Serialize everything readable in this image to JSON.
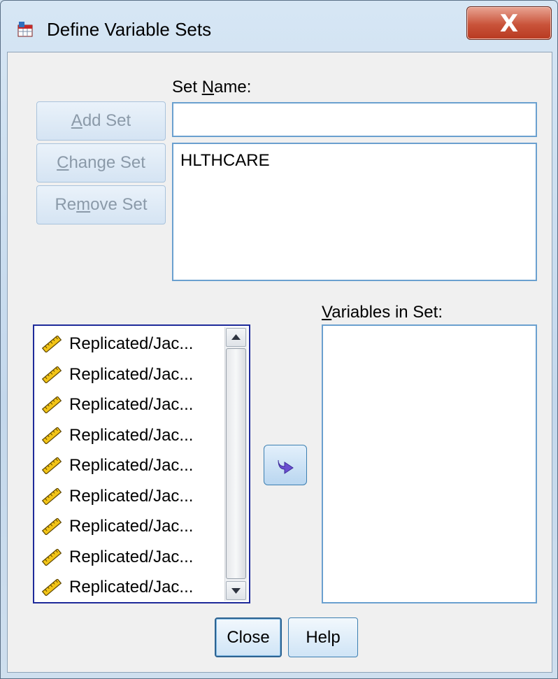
{
  "window": {
    "title": "Define Variable Sets",
    "close_glyph": "X"
  },
  "set_name": {
    "label_pre": "Set ",
    "label_ul": "N",
    "label_post": "ame:",
    "value": ""
  },
  "buttons": {
    "add_set": {
      "pre": "",
      "ul": "A",
      "post": "dd Set",
      "enabled": false
    },
    "change_set": {
      "pre": "",
      "ul": "C",
      "post": "hange Set",
      "enabled": false
    },
    "remove_set": {
      "pre": "Re",
      "ul": "m",
      "post": "ove Set",
      "enabled": false
    },
    "close": "Close",
    "help": "Help"
  },
  "sets_list": {
    "items": [
      "HLTHCARE"
    ]
  },
  "variables_in_set": {
    "label_ul": "V",
    "label_post": "ariables in Set:",
    "items": []
  },
  "variables_list": {
    "icon": "ruler-scale-icon",
    "items": [
      "Replicated/Jac...",
      "Replicated/Jac...",
      "Replicated/Jac...",
      "Replicated/Jac...",
      "Replicated/Jac...",
      "Replicated/Jac...",
      "Replicated/Jac...",
      "Replicated/Jac...",
      "Replicated/Jac..."
    ]
  },
  "transfer_button_icon": "right-arrow-icon",
  "colors": {
    "accent_blue": "#3c7fb1",
    "close_red": "#c9533a",
    "list_border": "#1e2a9a"
  }
}
